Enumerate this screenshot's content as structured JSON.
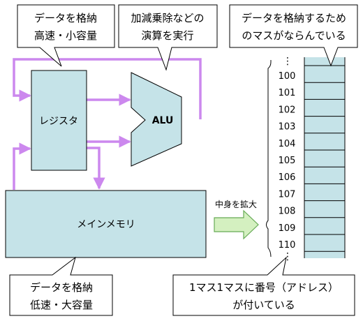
{
  "callouts": {
    "register_note": [
      "データを格納",
      "高速・小容量"
    ],
    "alu_note": [
      "加減乗除などの",
      "演算を実行"
    ],
    "memory_cells_note": [
      "データを格納するため",
      "のマスがならんでいる"
    ],
    "main_memory_note": [
      "データを格納",
      "低速・大容量"
    ],
    "address_note": [
      "1マス1マスに番号（アドレス）",
      "が付いている"
    ]
  },
  "blocks": {
    "register": "レジスタ",
    "alu": "ALU",
    "main_memory": "メインメモリ"
  },
  "expand_label": "中身を拡大",
  "addresses": [
    "100",
    "101",
    "102",
    "103",
    "104",
    "105",
    "106",
    "107",
    "108",
    "109",
    "110"
  ],
  "ellipsis": "⋮",
  "colors": {
    "block_fill": "#c5e3e8",
    "arrow": "#cc88ee",
    "expand_arrow_fill": "#d4f0c0",
    "expand_arrow_stroke": "#66aa55"
  }
}
